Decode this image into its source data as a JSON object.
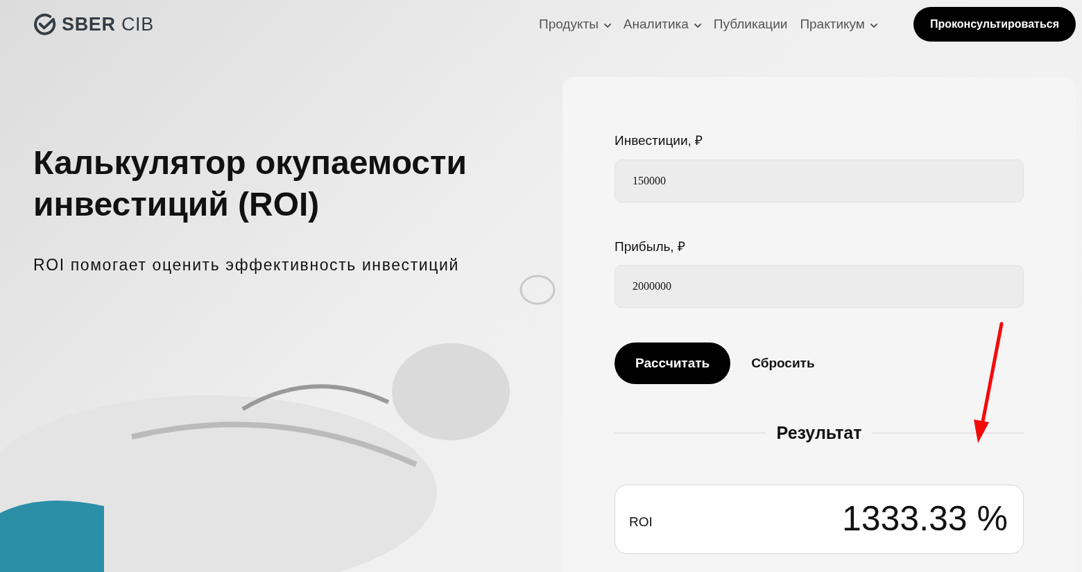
{
  "header": {
    "logo": {
      "text_bold": "SBER",
      "text_light": "CIB"
    },
    "nav": [
      {
        "label": "Продукты",
        "has_menu": true
      },
      {
        "label": "Аналитика",
        "has_menu": true
      },
      {
        "label": "Публикации",
        "has_menu": false
      },
      {
        "label": "Практикум",
        "has_menu": true
      }
    ],
    "cta": "Проконсультироваться"
  },
  "hero": {
    "title": "Калькулятор окупаемости инвестиций (ROI)",
    "subtitle": "ROI помогает оценить эффективность инвестиций"
  },
  "calculator": {
    "fields": [
      {
        "label": "Инвестиции, ₽",
        "value": "150000"
      },
      {
        "label": "Прибыль, ₽",
        "value": "2000000"
      }
    ],
    "buttons": [
      {
        "label": "Рассчитать",
        "kind": "primary"
      },
      {
        "label": "Сбросить",
        "kind": "text"
      }
    ],
    "result_heading": "Результат",
    "result": {
      "label": "ROI",
      "value": "1333.33 %"
    },
    "annotation_arrow": true
  }
}
